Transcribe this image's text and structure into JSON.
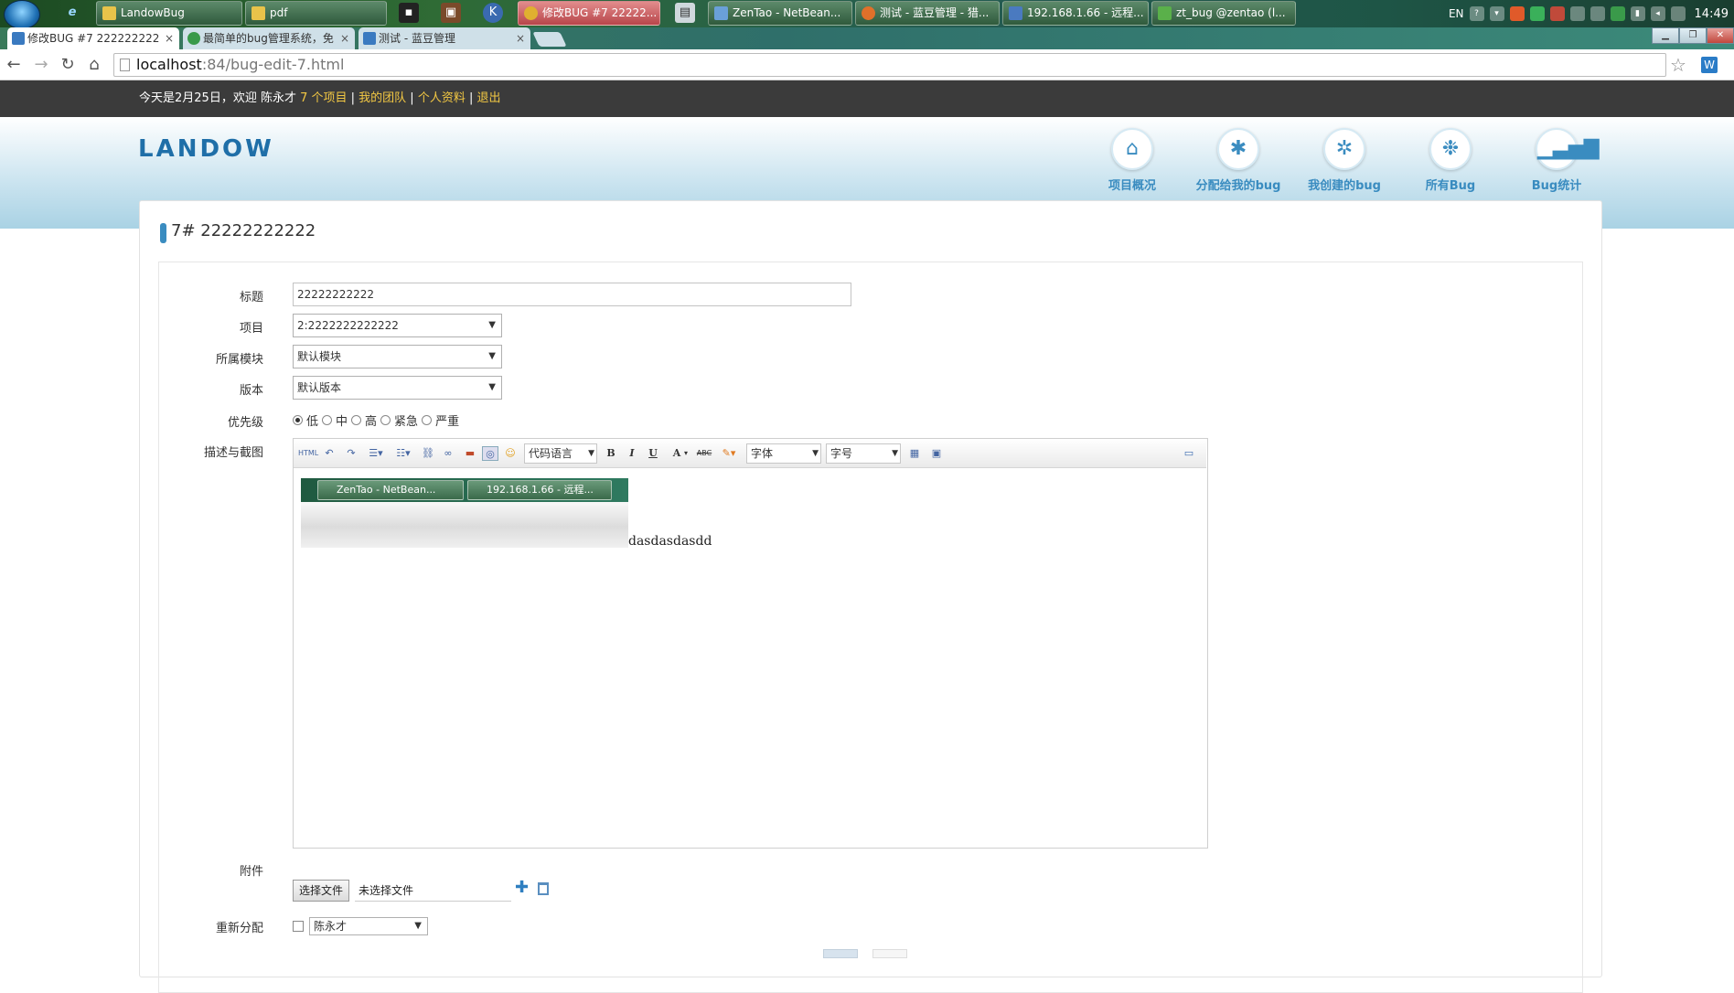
{
  "taskbar": {
    "items": [
      {
        "label": "LandowBug",
        "active": false
      },
      {
        "label": "pdf",
        "active": false
      },
      {
        "label": "修改BUG #7 22222...",
        "active": true
      },
      {
        "label": "ZenTao - NetBean...",
        "active": false
      },
      {
        "label": "测试 - 蓝豆管理 - 猎...",
        "active": false
      },
      {
        "label": "192.168.1.66 - 远程...",
        "active": false
      },
      {
        "label": "zt_bug @zentao (l...",
        "active": false
      }
    ],
    "tray_lang": "EN",
    "clock": "14:49"
  },
  "browser": {
    "tabs": [
      {
        "label": "修改BUG #7 222222222",
        "active": true
      },
      {
        "label": "最简单的bug管理系统，免",
        "active": false
      },
      {
        "label": "测试 - 蓝豆管理",
        "active": false
      }
    ],
    "url_host": "localhost",
    "url_path": ":84/bug-edit-7.html"
  },
  "topbar": {
    "greeting": "今天是2月25日，欢迎 陈永才 ",
    "projects_link": "7 个项目",
    "sep": " | ",
    "team_link": "我的团队",
    "profile_link": "个人资料",
    "logout_link": "退出"
  },
  "header": {
    "logo": "LANDOW",
    "nav": [
      {
        "label": "项目概况",
        "icon": "home-icon"
      },
      {
        "label": "分配给我的bug",
        "icon": "bug-icon"
      },
      {
        "label": "我创建的bug",
        "icon": "bug-add-icon"
      },
      {
        "label": "所有Bug",
        "icon": "bugs-icon"
      },
      {
        "label": "Bug统计",
        "icon": "stats-icon"
      }
    ]
  },
  "page": {
    "title_id": "7#",
    "title_text": "22222222222"
  },
  "form": {
    "title_label": "标题",
    "title_value": "22222222222",
    "project_label": "项目",
    "project_value": "2:2222222222222",
    "module_label": "所属模块",
    "module_value": "默认模块",
    "version_label": "版本",
    "version_value": "默认版本",
    "priority_label": "优先级",
    "priorities": [
      "低",
      "中",
      "高",
      "紧急",
      "严重"
    ],
    "priority_selected": "低",
    "desc_label": "描述与截图",
    "editor": {
      "html_btn": "HTML",
      "code_lang": "代码语言",
      "font": "字体",
      "size": "字号",
      "bold": "B",
      "italic": "I",
      "underline": "U",
      "color": "A",
      "strike": "ABC",
      "content_text": "dasdasdasdd",
      "shot_btn1": "ZenTao - NetBean...",
      "shot_btn2": "192.168.1.66 - 远程..."
    },
    "attach_label": "附件",
    "choose_file": "选择文件",
    "no_file": "未选择文件",
    "reassign_label": "重新分配",
    "assignee": "陈永才"
  }
}
